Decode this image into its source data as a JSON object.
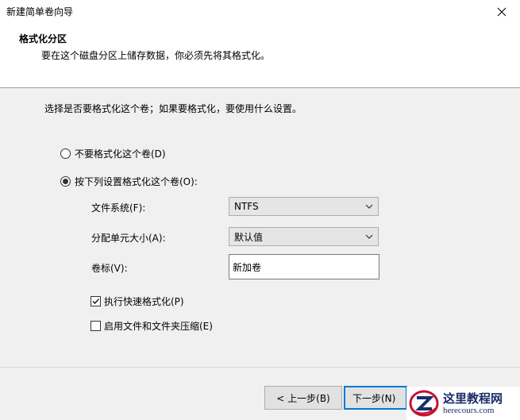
{
  "window": {
    "title": "新建简单卷向导"
  },
  "header": {
    "title": "格式化分区",
    "subtitle": "要在这个磁盘分区上储存数据，你必须先将其格式化。"
  },
  "instruction": "选择是否要格式化这个卷；如果要格式化，要使用什么设置。",
  "options": {
    "no_format": {
      "label": "不要格式化这个卷(D)",
      "selected": false
    },
    "format": {
      "label": "按下列设置格式化这个卷(O):",
      "selected": true
    }
  },
  "fields": {
    "file_system": {
      "label": "文件系统(F):",
      "value": "NTFS"
    },
    "allocation_size": {
      "label": "分配单元大小(A):",
      "value": "默认值"
    },
    "volume_label": {
      "label": "卷标(V):",
      "value": "新加卷"
    }
  },
  "checkboxes": {
    "quick_format": {
      "label": "执行快速格式化(P)",
      "checked": true
    },
    "compression": {
      "label": "启用文件和文件夹压缩(E)",
      "checked": false
    }
  },
  "buttons": {
    "back": "< 上一步(B)",
    "next": "下一步(N)"
  },
  "watermark": {
    "title": "这里教程网",
    "url": "herecours.com"
  },
  "colors": {
    "accent": "#0078d7",
    "watermark": "#1a2d6b"
  }
}
